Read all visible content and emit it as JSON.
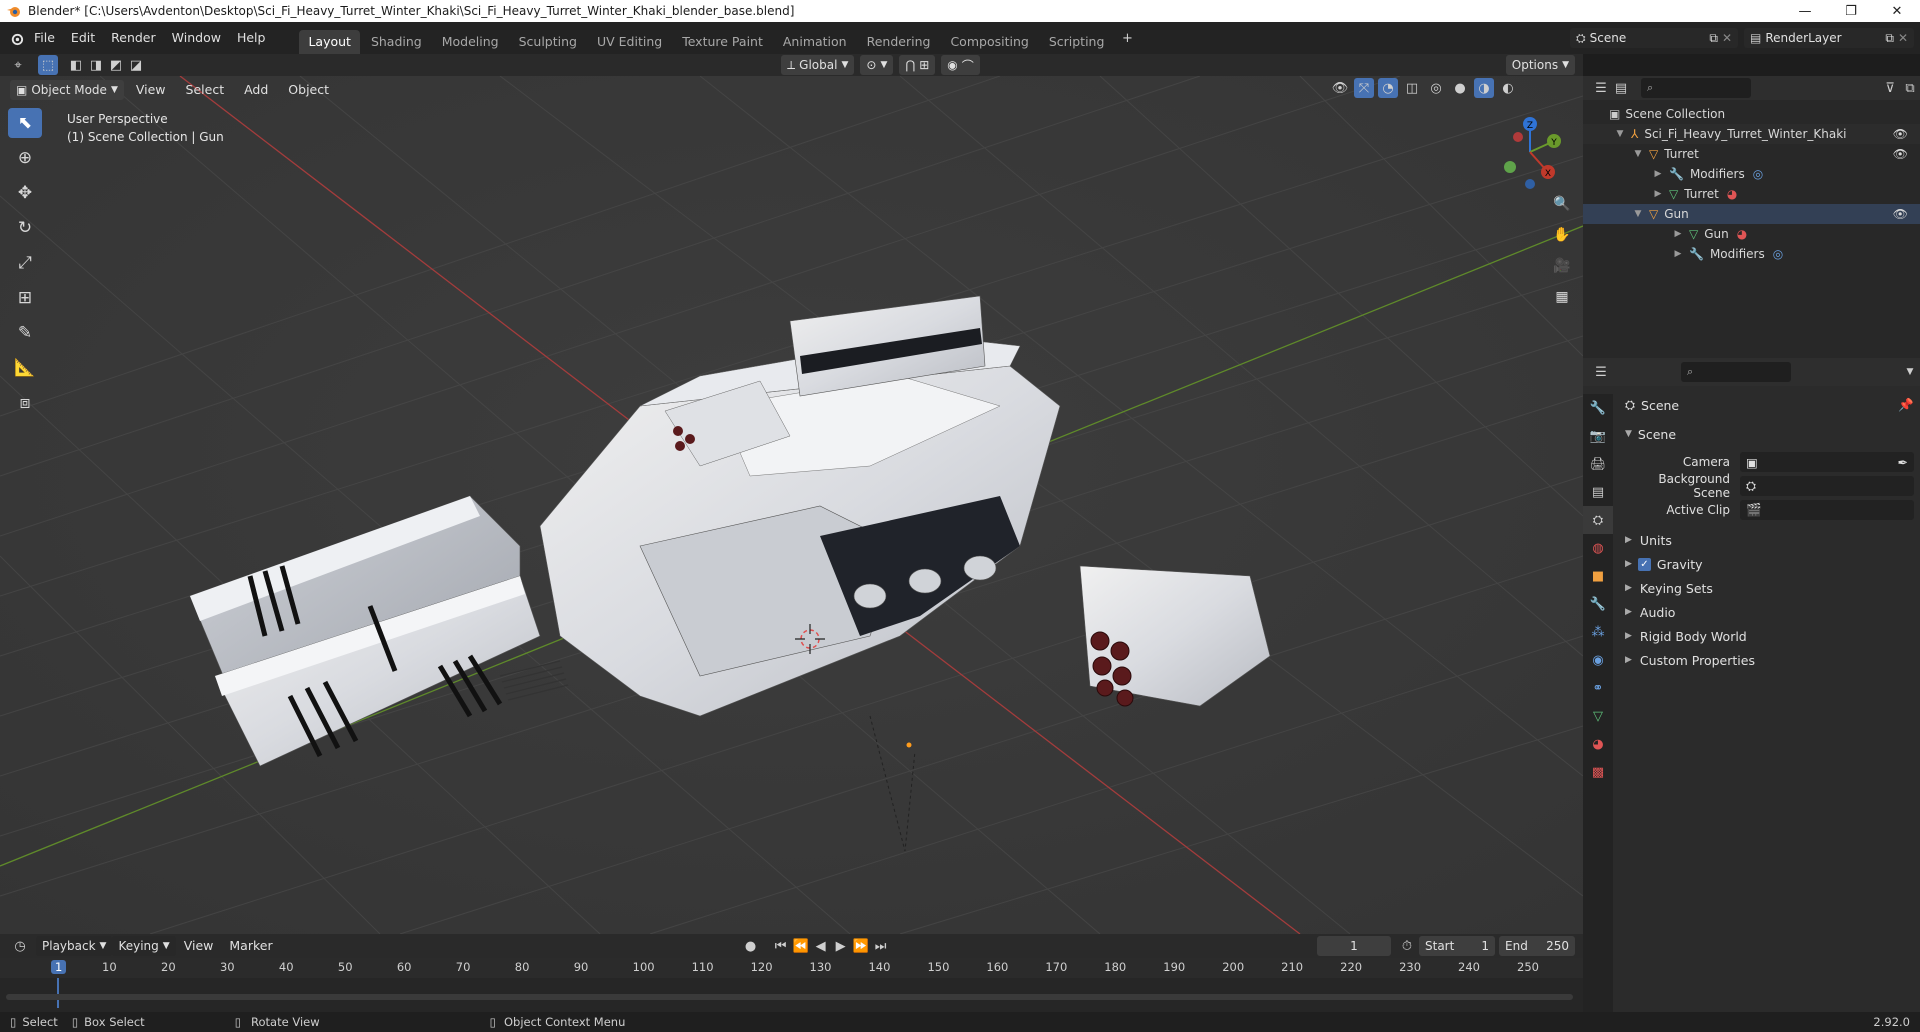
{
  "window": {
    "title": "Blender* [C:\\Users\\Avdenton\\Desktop\\Sci_Fi_Heavy_Turret_Winter_Khaki\\Sci_Fi_Heavy_Turret_Winter_Khaki_blender_base.blend]",
    "minimize": "—",
    "maximize": "❐",
    "close": "✕"
  },
  "menu": {
    "file": "File",
    "edit": "Edit",
    "render": "Render",
    "window": "Window",
    "help": "Help"
  },
  "workspaces": [
    "Layout",
    "Shading",
    "Modeling",
    "Sculpting",
    "UV Editing",
    "Texture Paint",
    "Animation",
    "Rendering",
    "Compositing",
    "Scripting"
  ],
  "scene_selector": {
    "scene": "Scene",
    "view_layer": "RenderLayer"
  },
  "viewport_header": {
    "transform_orientation": "Global",
    "options": "Options",
    "mode": "Object Mode",
    "view": "View",
    "select": "Select",
    "add": "Add",
    "object": "Object"
  },
  "viewport_overlay": {
    "perspective": "User Perspective",
    "collection_info": "(1) Scene Collection | Gun"
  },
  "gizmo": {
    "z": "Z",
    "y": "Y",
    "x": "X"
  },
  "outliner": {
    "root": "Scene Collection",
    "items": [
      {
        "label": "Sci_Fi_Heavy_Turret_Winter_Khaki",
        "depth": 1
      },
      {
        "label": "Turret",
        "depth": 2
      },
      {
        "label": "Modifiers",
        "depth": 3
      },
      {
        "label": "Turret",
        "depth": 3
      },
      {
        "label": "Gun",
        "depth": 2
      },
      {
        "label": "Gun",
        "depth": 3
      },
      {
        "label": "Modifiers",
        "depth": 3
      }
    ]
  },
  "properties": {
    "breadcrumb": "Scene",
    "panel_title": "Scene",
    "camera_label": "Camera",
    "background_scene_label": "Background Scene",
    "active_clip_label": "Active Clip",
    "subpanels": [
      "Units",
      "Gravity",
      "Keying Sets",
      "Audio",
      "Rigid Body World",
      "Custom Properties"
    ]
  },
  "timeline": {
    "playback": "Playback",
    "keying": "Keying",
    "view": "View",
    "marker": "Marker",
    "current_frame": "1",
    "start_label": "Start",
    "start_value": "1",
    "end_label": "End",
    "end_value": "250",
    "ruler": [
      "1",
      "10",
      "20",
      "30",
      "40",
      "50",
      "60",
      "70",
      "80",
      "90",
      "100",
      "110",
      "120",
      "130",
      "140",
      "150",
      "160",
      "170",
      "180",
      "190",
      "200",
      "210",
      "220",
      "230",
      "240",
      "250"
    ]
  },
  "statusbar": {
    "select": "Select",
    "box_select": "Box Select",
    "rotate_view": "Rotate View",
    "context_menu": "Object Context Menu",
    "version": "2.92.0"
  },
  "colors": {
    "accent": "#4772b3",
    "x_axis": "#c0392b",
    "y_axis": "#6a9a2b",
    "z_axis": "#2f73d6"
  }
}
